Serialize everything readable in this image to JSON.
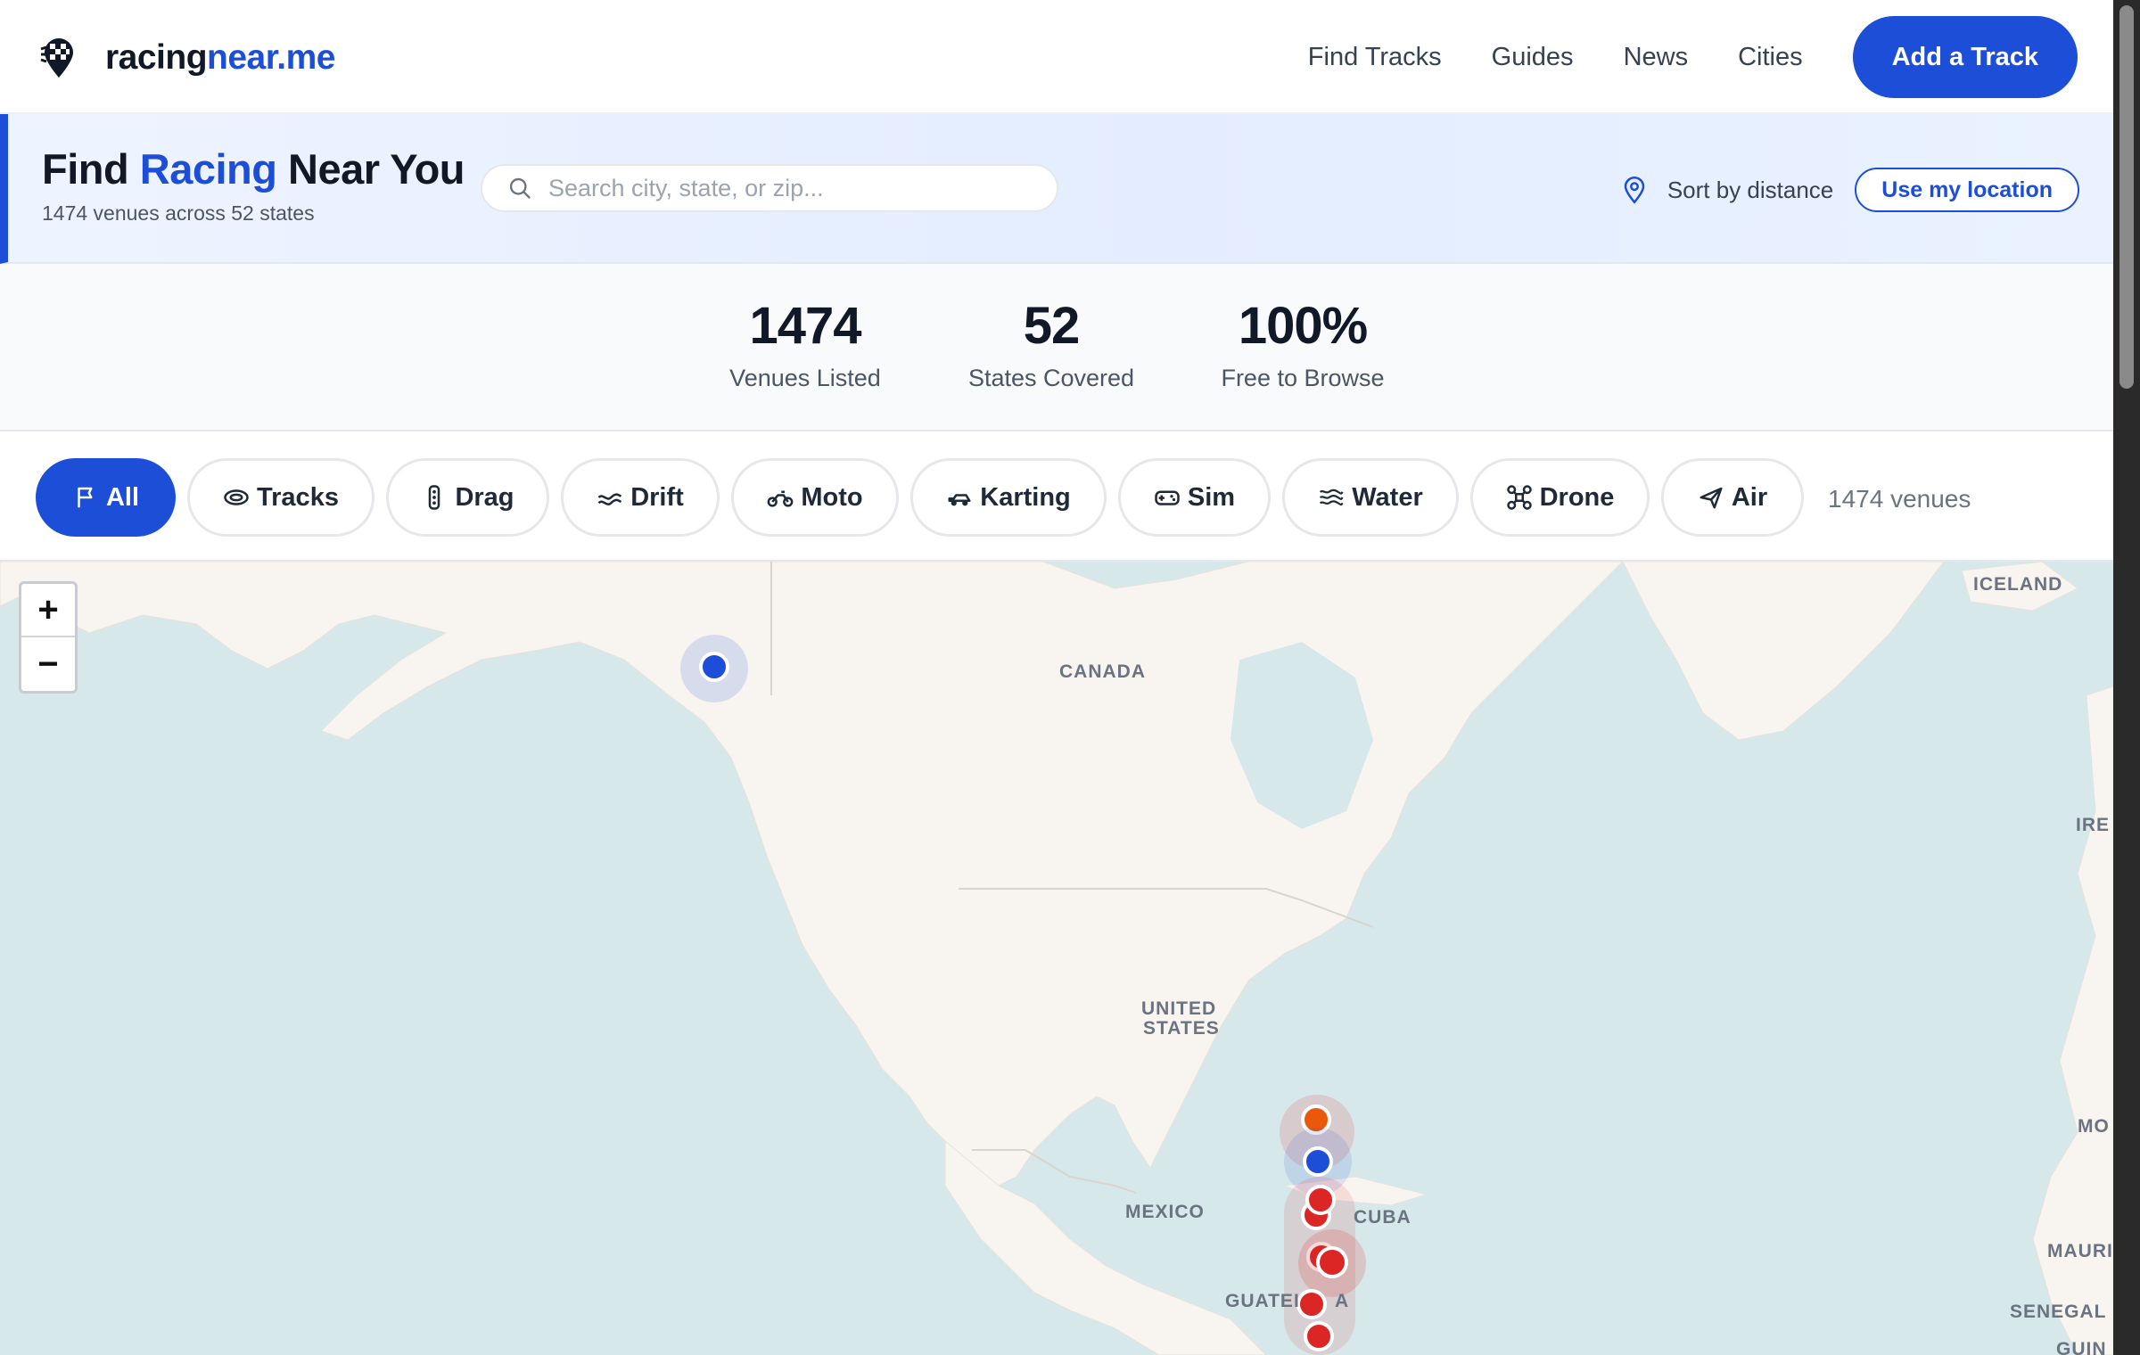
{
  "header": {
    "logo_part1": "racing",
    "logo_part2": "near.me",
    "nav": [
      "Find Tracks",
      "Guides",
      "News",
      "Cities"
    ],
    "cta": "Add a Track"
  },
  "hero": {
    "title_pre": "Find ",
    "title_highlight": "Racing",
    "title_post": " Near You",
    "subtitle": "1474 venues across 52 states",
    "search_placeholder": "Search city, state, or zip...",
    "sort_label": "Sort by distance",
    "location_button": "Use my location"
  },
  "stats": [
    {
      "value": "1474",
      "label": "Venues Listed"
    },
    {
      "value": "52",
      "label": "States Covered"
    },
    {
      "value": "100%",
      "label": "Free to Browse"
    }
  ],
  "filters": {
    "chips": [
      {
        "label": "All",
        "icon": "flag-icon",
        "active": true
      },
      {
        "label": "Tracks",
        "icon": "oval-track-icon"
      },
      {
        "label": "Drag",
        "icon": "drag-light-icon"
      },
      {
        "label": "Drift",
        "icon": "drift-icon"
      },
      {
        "label": "Moto",
        "icon": "motorcycle-icon"
      },
      {
        "label": "Karting",
        "icon": "kart-icon"
      },
      {
        "label": "Sim",
        "icon": "gamepad-icon"
      },
      {
        "label": "Water",
        "icon": "waves-icon"
      },
      {
        "label": "Drone",
        "icon": "drone-icon"
      },
      {
        "label": "Air",
        "icon": "plane-icon"
      }
    ],
    "count": "1474 venues"
  },
  "map": {
    "zoom_in": "+",
    "zoom_out": "−",
    "labels": {
      "iceland": "ICELAND",
      "canada": "CANADA",
      "ire": "IRE",
      "us_line1": "UNITED",
      "us_line2": "STATES",
      "mo": "MO",
      "mexico": "MEXICO",
      "cuba": "CUBA",
      "mauri": "MAURI",
      "guatemala": "GUATEI",
      "guatemala_end": "A",
      "senegal": "SENEGAL",
      "guin": "GUIN"
    },
    "colors": {
      "water": "#d7e8ea",
      "land": "#f8f5f1",
      "blue": "#1d4ed8",
      "red": "#dc2626",
      "orange": "#ea580c"
    }
  }
}
